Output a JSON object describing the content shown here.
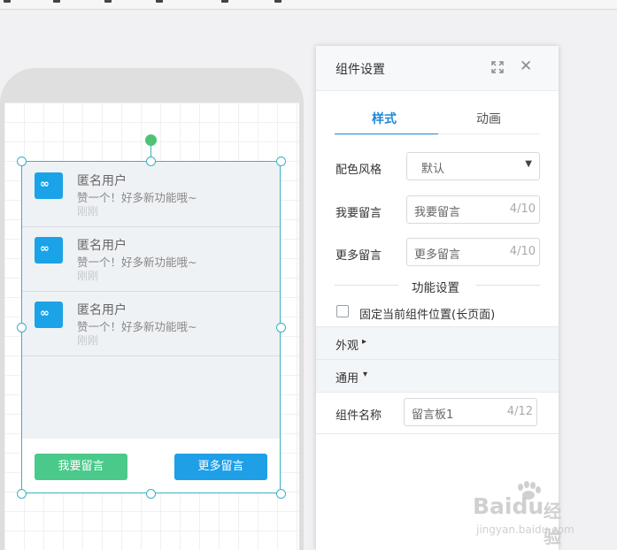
{
  "panel": {
    "title": "组件设置",
    "tabs": [
      {
        "label": "样式",
        "active": true
      },
      {
        "label": "动画",
        "active": false
      }
    ],
    "fields": {
      "color_style": {
        "label": "配色风格",
        "value": "默认"
      },
      "my_message": {
        "label": "我要留言",
        "value": "我要留言",
        "count": "4/10"
      },
      "more_message": {
        "label": "更多留言",
        "value": "更多留言",
        "count": "4/10"
      }
    },
    "function_section": "功能设置",
    "fix_position": {
      "label": "固定当前组件位置(长页面)",
      "checked": false
    },
    "appearance": "外观",
    "general": "通用",
    "component_name": {
      "label": "组件名称",
      "value": "留言板1",
      "count": "4/12"
    }
  },
  "messages": [
    {
      "name": "匿名用户",
      "text": "赞一个！好多新功能哦~",
      "time": "刚刚"
    },
    {
      "name": "匿名用户",
      "text": "赞一个！好多新功能哦~",
      "time": "刚刚"
    },
    {
      "name": "匿名用户",
      "text": "赞一个！好多新功能哦~",
      "time": "刚刚"
    }
  ],
  "avatar_glyph": "∞",
  "buttons": {
    "my_message": "我要留言",
    "more_message": "更多留言"
  },
  "watermark": {
    "brand": "Baidu",
    "cn": "经验",
    "url": "jingyan.baidu.com"
  },
  "colors": {
    "accent": "#1c88d8",
    "green_button": "#4ac98b",
    "blue_button": "#1e9fe6",
    "avatar": "#1aa3e6",
    "selection": "#3ab0c8"
  }
}
